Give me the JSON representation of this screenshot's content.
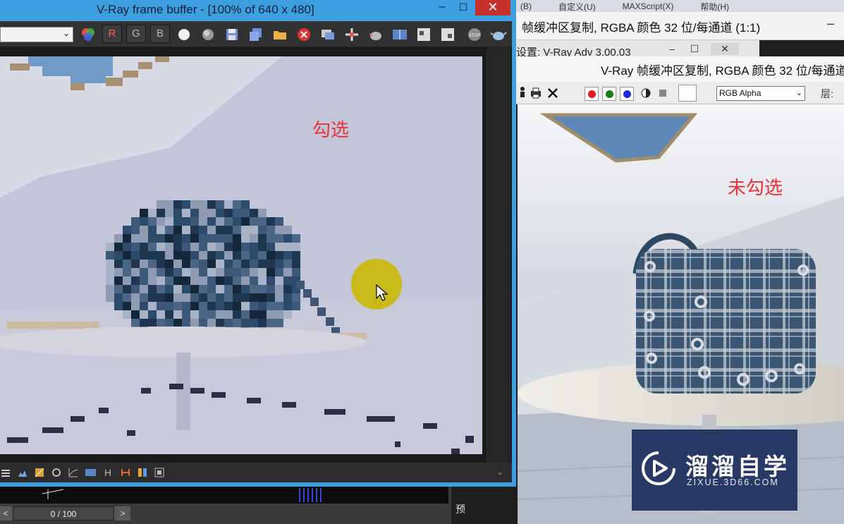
{
  "background_windows": {
    "menu": [
      "(B)",
      "自定义(U)",
      "MAXScript(X)",
      "帮助(H)"
    ],
    "copy_window_1": {
      "title": "帧缓冲区复制, RGBA 颜色 32 位/每通道 (1:1)",
      "minimize": "–"
    },
    "settings_window": {
      "title": "设置: V-Ray Adv 3.00.03",
      "minimize": "–",
      "maximize": "☐",
      "close": "✕"
    },
    "copy_window_2": {
      "title": "V-Ray 帧缓冲区复制, RGBA 颜色 32 位/每通道"
    },
    "copy_toolbar": {
      "channel_select_value": "RGB Alpha",
      "layer_label": "层:",
      "swatch_colors": [
        "#e11b1b",
        "#1a7d1a",
        "#1c2fd6"
      ]
    },
    "annotation": "未勾选"
  },
  "vfb": {
    "title": "V-Ray frame buffer - [100% of 640 x 480]",
    "minimize": "–",
    "maximize": "☐",
    "close": "✕",
    "channel_buttons": [
      "R",
      "G",
      "B"
    ],
    "annotation": "勾选",
    "bottom_icon_h": "H"
  },
  "timeline": {
    "frame_counter": "0 / 100",
    "prev": "<",
    "next": ">",
    "preview_label": "预"
  },
  "watermark": {
    "name": "溜溜自学",
    "url": "ZIXUE.3D66.COM"
  },
  "colors": {
    "title_bar_blue": "#3d9ee0",
    "close_red": "#c7312b",
    "annotation_red": "#e8333a",
    "cursor_highlight": "#c9b80a",
    "watermark_bg": "#1c2e5c"
  }
}
